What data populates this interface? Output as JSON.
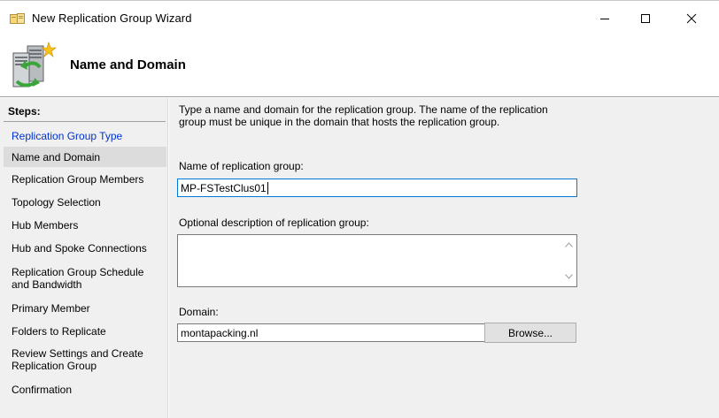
{
  "window": {
    "title": "New Replication Group Wizard",
    "controls": [
      "minimize",
      "maximize",
      "close"
    ]
  },
  "header": {
    "title": "Name and Domain",
    "icon": "replication-servers-icon"
  },
  "steps": {
    "heading": "Steps:",
    "items": [
      {
        "label": "Replication Group Type",
        "state": "link"
      },
      {
        "label": "Name and Domain",
        "state": "active"
      },
      {
        "label": "Replication Group Members",
        "state": "normal"
      },
      {
        "label": "Topology Selection",
        "state": "normal"
      },
      {
        "label": "Hub Members",
        "state": "normal"
      },
      {
        "label": "Hub and Spoke Connections",
        "state": "normal"
      },
      {
        "label": "Replication Group Schedule and Bandwidth",
        "state": "normal"
      },
      {
        "label": "Primary Member",
        "state": "normal"
      },
      {
        "label": "Folders to Replicate",
        "state": "normal"
      },
      {
        "label": "Review Settings and Create Replication Group",
        "state": "normal"
      },
      {
        "label": "Confirmation",
        "state": "normal"
      }
    ]
  },
  "form": {
    "description": "Type a name and domain for the replication group. The name of the replication group must be unique in the domain that hosts the replication group.",
    "name_label": "Name of replication group:",
    "name_value": "MP-FSTestClus01",
    "optional_label": "Optional description of replication group:",
    "optional_value": "",
    "domain_label": "Domain:",
    "domain_value": "montapacking.nl",
    "browse_label": "Browse..."
  },
  "colors": {
    "link": "#0033cc",
    "panel_bg": "#f0f0f0",
    "active_step_bg": "#dcdcdc",
    "focus_border": "#0078d7"
  }
}
